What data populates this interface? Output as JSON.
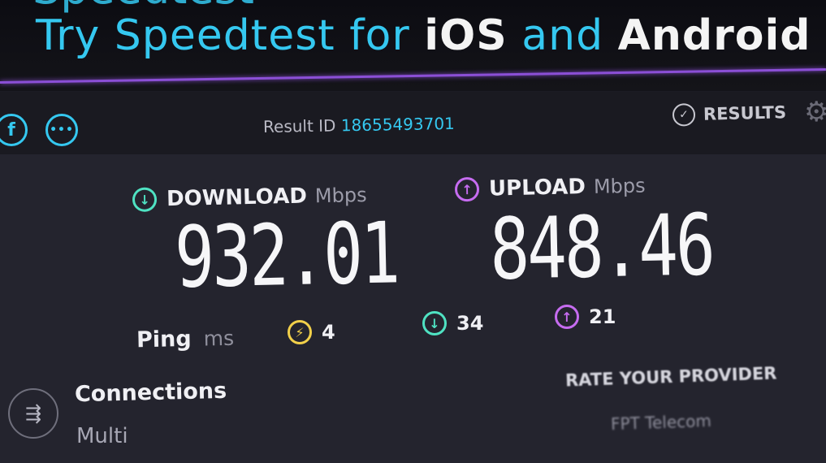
{
  "banner": {
    "line1_partial": "Speedtest",
    "line2_prefix": "Try Speedtest for ",
    "line2_ios": "iOS",
    "line2_and": " and ",
    "line2_android": "Android"
  },
  "result_bar": {
    "facebook_glyph": "f",
    "more_glyph": "•••",
    "result_id_label": "Result ID",
    "result_id_value": "18655493701",
    "results_label": "RESULTS"
  },
  "download": {
    "label": "DOWNLOAD",
    "unit": "Mbps",
    "value": "932.01"
  },
  "upload": {
    "label": "UPLOAD",
    "unit": "Mbps",
    "value": "848.46"
  },
  "ping": {
    "label": "Ping",
    "unit": "ms",
    "idle": "4",
    "download": "34",
    "upload": "21"
  },
  "connections": {
    "title": "Connections",
    "value": "Multi"
  },
  "rate": {
    "title": "RATE YOUR PROVIDER",
    "provider": "FPT Telecom"
  },
  "colors": {
    "accent_blue": "#35c8f0",
    "download_teal": "#4fe2c2",
    "upload_violet": "#c66cf0",
    "ping_yellow": "#f2d04a",
    "divider_purple": "#8b4fd6"
  },
  "icons": [
    "facebook-icon",
    "more-icon",
    "check-circle-icon",
    "gear-icon",
    "download-arrow-icon",
    "upload-arrow-icon",
    "ping-icon",
    "connections-icon"
  ]
}
